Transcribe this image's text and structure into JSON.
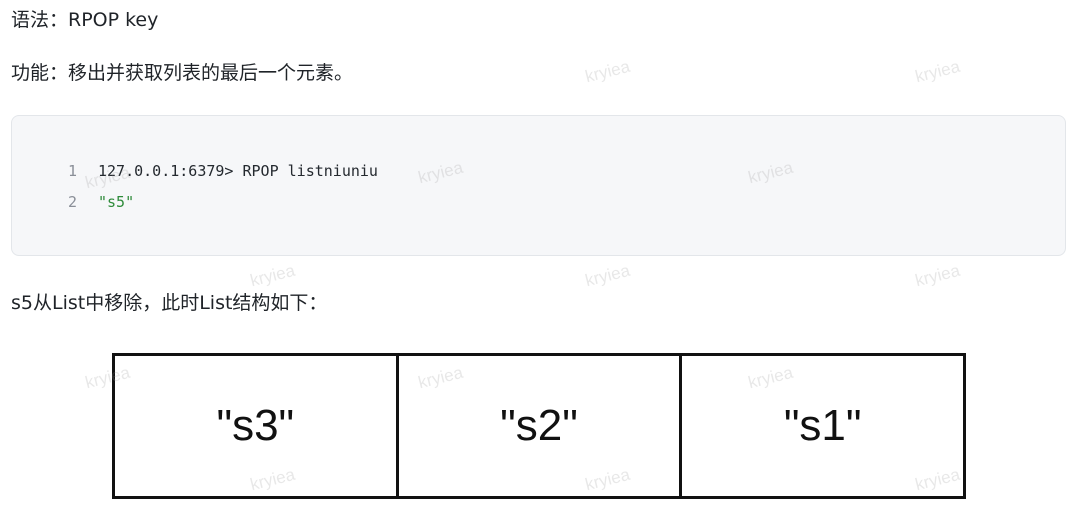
{
  "syntax_line": "语法：RPOP key",
  "function_line": "功能：移出并获取列表的最后一个元素。",
  "code": {
    "lines": [
      {
        "num": "1",
        "text": "127.0.0.1:6379> RPOP listniuniu",
        "kind": "command"
      },
      {
        "num": "2",
        "text": "\"s5\"",
        "kind": "string"
      }
    ]
  },
  "note_line": "s5从List中移除，此时List结构如下：",
  "list_structure": {
    "cells": [
      "\"s3\"",
      "\"s2\"",
      "\"s1\""
    ]
  },
  "watermark": "kryiea"
}
